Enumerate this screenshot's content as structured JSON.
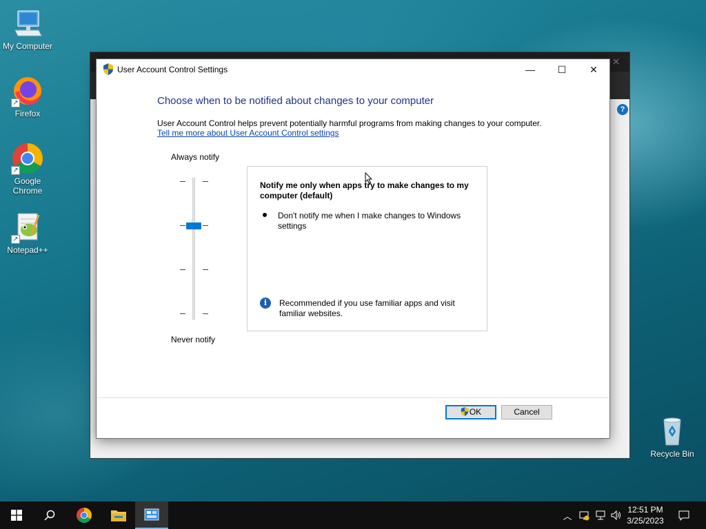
{
  "desktop": {
    "icons": [
      {
        "label": "My Computer"
      },
      {
        "label": "Firefox"
      },
      {
        "label": "Google Chrome"
      },
      {
        "label": "Notepad++"
      },
      {
        "label": "Recycle Bin"
      }
    ]
  },
  "dialog": {
    "title": "User Account Control Settings",
    "heading": "Choose when to be notified about changes to your computer",
    "description": "User Account Control helps prevent potentially harmful programs from making changes to your computer.",
    "link": "Tell me more about User Account Control settings",
    "slider": {
      "top_label": "Always notify",
      "bottom_label": "Never notify",
      "levels": 4,
      "selected_level": 3
    },
    "info": {
      "title": "Notify me only when apps try to make changes to my computer (default)",
      "bullet": "Don't notify me when I make changes to Windows settings",
      "recommendation": "Recommended if you use familiar apps and visit familiar websites."
    },
    "buttons": {
      "ok": "OK",
      "cancel": "Cancel"
    }
  },
  "taskbar": {
    "time": "12:51 PM",
    "date": "3/25/2023"
  },
  "colors": {
    "accent": "#0078d7",
    "heading": "#1e3287",
    "link": "#0645ad"
  }
}
